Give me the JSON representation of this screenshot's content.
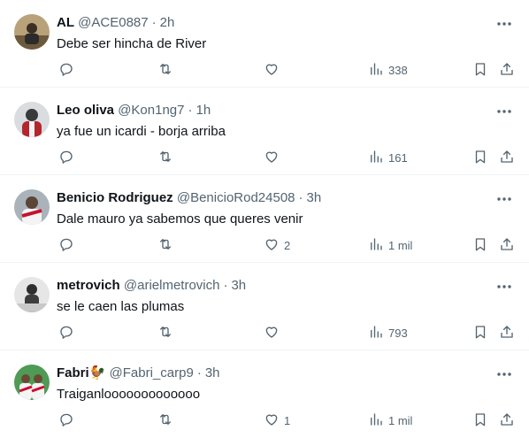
{
  "replies": [
    {
      "name": "AL",
      "handle": "@ACE0887",
      "time": "2h",
      "text": "Debe ser hincha de River",
      "likes": "",
      "views": "338"
    },
    {
      "name": "Leo oliva",
      "handle": "@Kon1ng7",
      "time": "1h",
      "text": "ya fue un icardi - borja arriba",
      "likes": "",
      "views": "161"
    },
    {
      "name": "Benicio Rodriguez",
      "handle": "@BenicioRod24508",
      "time": "3h",
      "text": "Dale mauro ya sabemos que queres venir",
      "likes": "2",
      "views": "1 mil"
    },
    {
      "name": "metrovich",
      "handle": "@arielmetrovich",
      "time": "3h",
      "text": "se le caen las plumas",
      "likes": "",
      "views": "793"
    },
    {
      "name": "Fabri🐓",
      "handle": "@Fabri_carp9",
      "time": "3h",
      "text": "Traiganlooooooooooooo",
      "likes": "1",
      "views": "1 mil"
    }
  ],
  "separator": "·",
  "colors": {
    "name": "#0f1419",
    "muted": "#536471",
    "border": "#eff3f4"
  },
  "icons": [
    "reply-icon",
    "retweet-icon",
    "like-icon",
    "views-icon",
    "bookmark-icon",
    "share-icon",
    "more-icon"
  ]
}
